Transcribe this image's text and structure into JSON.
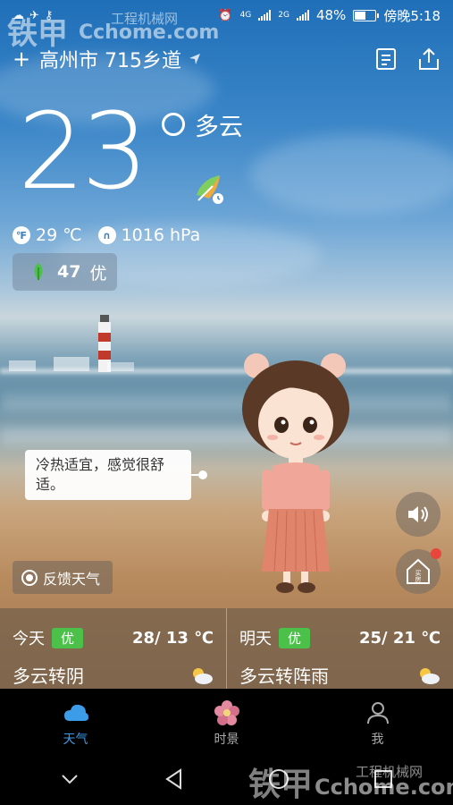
{
  "status_bar": {
    "signal1": "4G",
    "signal2": "2G",
    "battery": "48%",
    "time": "傍晚5:18"
  },
  "watermark": {
    "top_brand": "铁甲",
    "top_sub": "工程机械网",
    "top_url": "Cchome.com",
    "bottom_brand": "铁甲",
    "bottom_sub": "工程机械网",
    "bottom_url": "Cchome.com"
  },
  "header": {
    "add_symbol": "+",
    "location": "高州市 715乡道"
  },
  "current": {
    "temperature": "23",
    "condition": "多云",
    "feels_like": "29 ℃",
    "pressure": "1016 hPa",
    "aqi_value": "47",
    "aqi_level": "优",
    "tip": "冷热适宜，感觉很舒适。"
  },
  "feedback_label": "反馈天气",
  "house_label": "买房",
  "forecast": [
    {
      "day": "今天",
      "quality": "优",
      "range": "28/ 13 ℃",
      "condition": "多云转阴"
    },
    {
      "day": "明天",
      "quality": "优",
      "range": "25/ 21 ℃",
      "condition": "多云转阵雨"
    }
  ],
  "tabs": [
    {
      "label": "天气",
      "icon": "cloud-icon",
      "active": true
    },
    {
      "label": "时景",
      "icon": "flower-icon",
      "active": false
    },
    {
      "label": "我",
      "icon": "person-icon",
      "active": false
    }
  ],
  "colors": {
    "accent": "#3d9ce8",
    "aqi_good": "#4cc14a",
    "badge_red": "#e8463a"
  }
}
